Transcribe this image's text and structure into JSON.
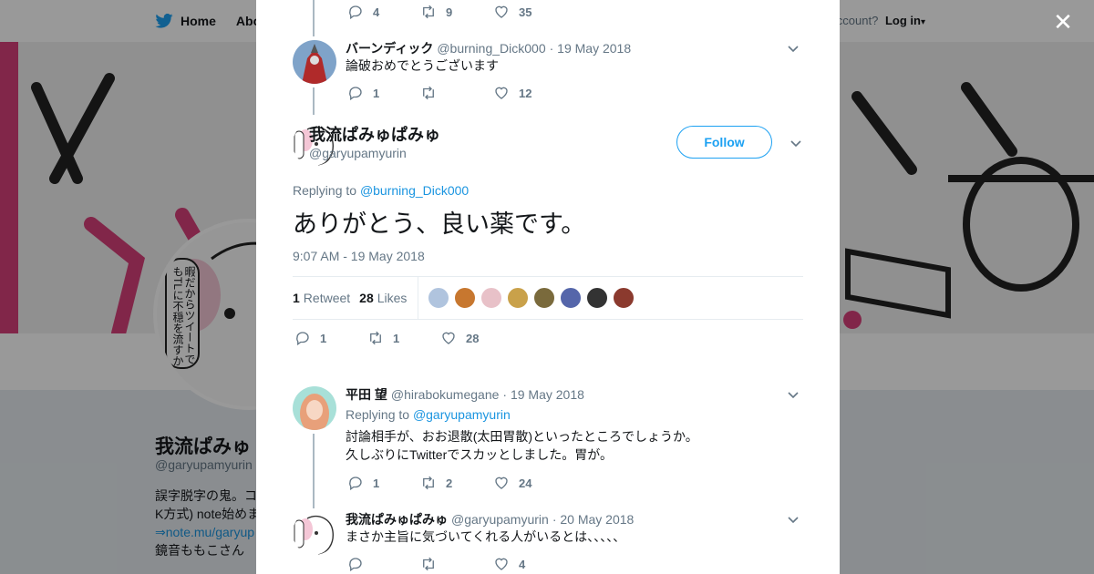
{
  "background": {
    "nav": {
      "home_label": "Home",
      "about_label": "Abo",
      "account_prompt": "ccount?",
      "login_label": "Log in"
    },
    "profile": {
      "name": "我流ぱみゅ",
      "handle": "@garyupamyurin",
      "bio_line1": "誤字脱字の鬼。コ",
      "bio_line2": "K方式) note始めま",
      "bio_link": "⇒note.mu/garyup",
      "bio_line4": "鏡音ももこさん",
      "avatar_text": "暇だからツイートでもTLに不穏を流すか"
    }
  },
  "modal": {
    "close_icon": "close-icon",
    "top_actions": {
      "replies": "4",
      "retweets": "9",
      "likes": "35"
    },
    "tweet1": {
      "name": "バーンディック",
      "handle": "@burning_Dick000",
      "date": "· 19 May 2018",
      "text": "論破おめでとうございます",
      "replies": "1",
      "retweets": "",
      "likes": "12"
    },
    "main": {
      "name": "我流ぱみゅぱみゅ",
      "handle": "@garyupamyurin",
      "follow_label": "Follow",
      "replying_prefix": "Replying to",
      "replying_to": "@burning_Dick000",
      "text": "ありがとう、良い薬です。",
      "timestamp": "9:07 AM - 19 May 2018",
      "retweet_count": "1",
      "retweet_label": "Retweet",
      "like_count": "28",
      "like_label": "Likes",
      "likers": [
        "#b0c4de",
        "#c7772f",
        "#e8c1c8",
        "#c9a14a",
        "#7a6a3c",
        "#5566aa",
        "#333333",
        "#8b3a2e"
      ],
      "replies": "1",
      "retweets": "1",
      "likes": "28"
    },
    "tweet2": {
      "name": "平田 望",
      "handle": "@hirabokumegane",
      "date": "· 19 May 2018",
      "replying_prefix": "Replying to",
      "replying_to": "@garyupamyurin",
      "text_line1": "討論相手が、おお退散(太田胃散)といったところでしょうか。",
      "text_line2": "久しぶりにTwitterでスカッとしました。胃が。",
      "replies": "1",
      "retweets": "2",
      "likes": "24"
    },
    "tweet3": {
      "name": "我流ぱみゅぱみゅ",
      "handle": "@garyupamyurin",
      "date": "· 20 May 2018",
      "text": "まさか主旨に気づいてくれる人がいるとは、、、、、",
      "replies": "",
      "retweets": "",
      "likes": "4"
    }
  }
}
